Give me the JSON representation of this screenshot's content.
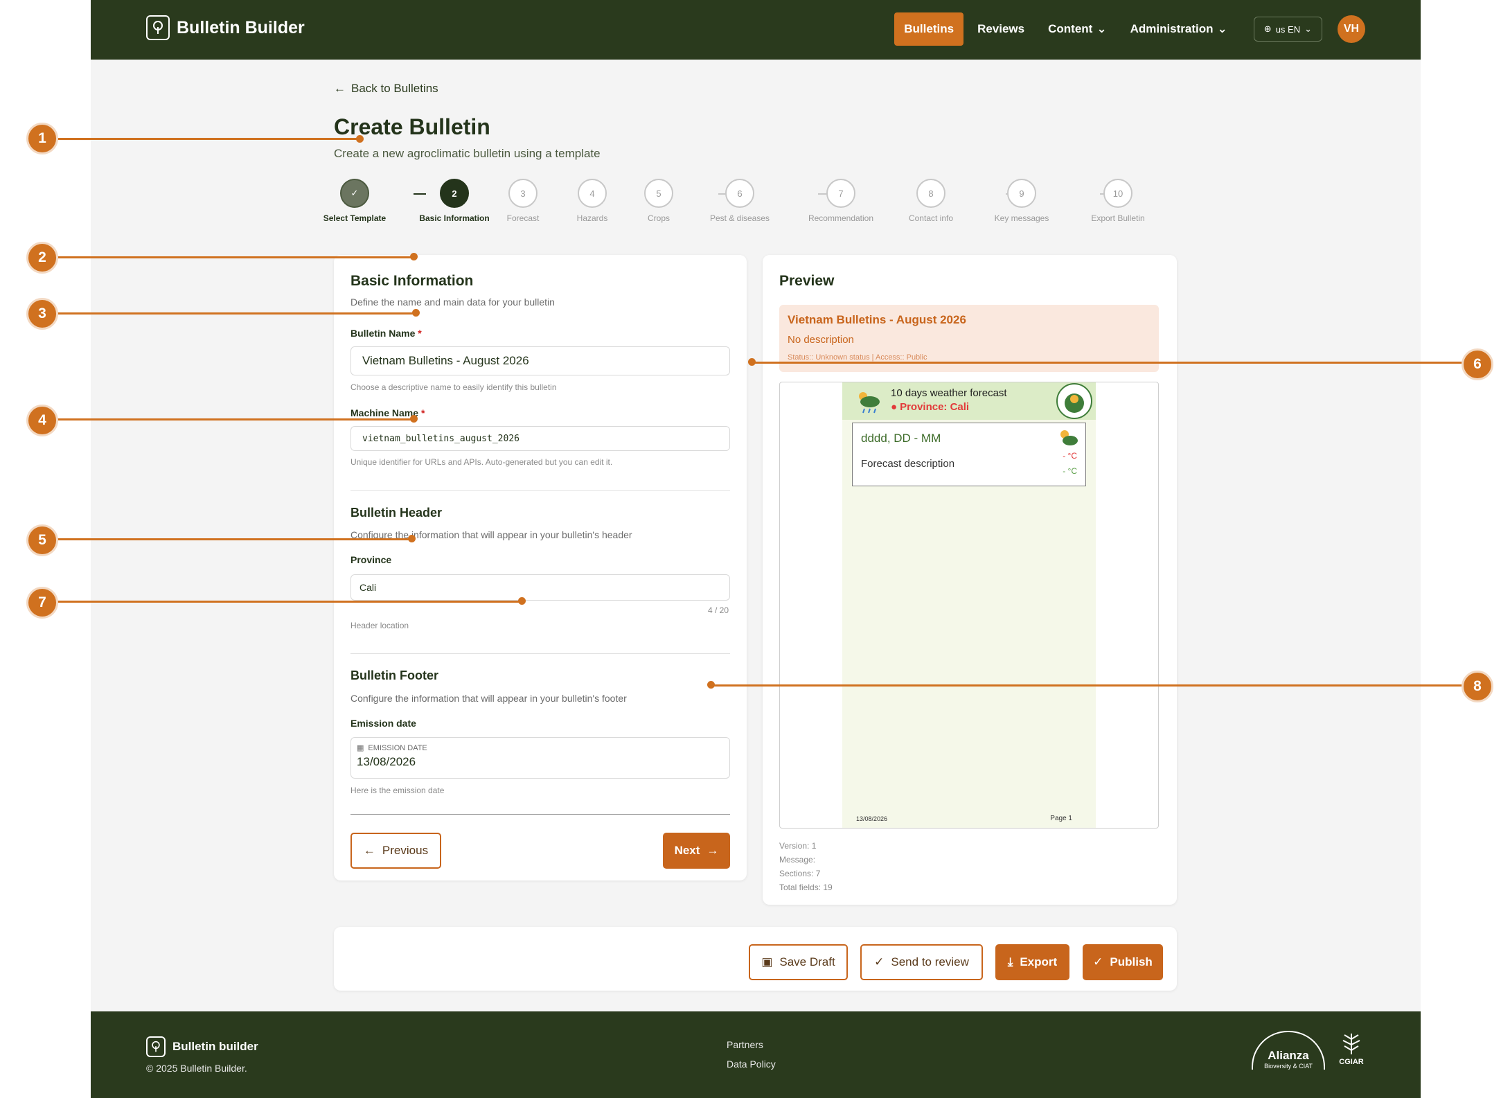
{
  "header": {
    "brand": "Bulletin Builder",
    "nav": [
      {
        "label": "Bulletins"
      },
      {
        "label": "Reviews"
      },
      {
        "label": "Content"
      },
      {
        "label": "Administration"
      }
    ],
    "lang": "us EN",
    "avatar": "VH"
  },
  "page": {
    "back": "Back to Bulletins",
    "title": "Create Bulletin",
    "subtitle": "Create a new agroclimatic bulletin using a template"
  },
  "steps": [
    {
      "num": "",
      "label": "Select Template"
    },
    {
      "num": "2",
      "label": "Basic Information"
    },
    {
      "num": "3",
      "label": "Forecast"
    },
    {
      "num": "4",
      "label": "Hazards"
    },
    {
      "num": "5",
      "label": "Crops"
    },
    {
      "num": "6",
      "label": "Pest & diseases"
    },
    {
      "num": "7",
      "label": "Recommendation"
    },
    {
      "num": "8",
      "label": "Contact info"
    },
    {
      "num": "9",
      "label": "Key messages"
    },
    {
      "num": "10",
      "label": "Export Bulletin"
    }
  ],
  "form": {
    "basic_title": "Basic Information",
    "basic_sub": "Define the name and main data for your bulletin",
    "name_label": "Bulletin Name",
    "name_value": "Vietnam Bulletins - August 2026",
    "name_hint": "Choose a descriptive name to easily identify this bulletin",
    "machine_label": "Machine Name",
    "machine_value": "vietnam_bulletins_august_2026",
    "machine_hint": "Unique identifier for URLs and APIs. Auto-generated but you can edit it.",
    "header_title": "Bulletin Header",
    "header_sub": "Configure the information that will appear in your bulletin's header",
    "province_label": "Province",
    "province_value": "Cali",
    "province_count": "4 / 20",
    "province_hint": "Header location",
    "footer_title": "Bulletin Footer",
    "footer_sub": "Configure the information that will appear in your bulletin's footer",
    "emission_label": "Emission date",
    "emission_mini": "EMISSION DATE",
    "emission_value": "13/08/2026",
    "emission_hint": "Here is the emission date",
    "prev_btn": "Previous",
    "next_btn": "Next"
  },
  "preview": {
    "title": "Preview",
    "bulletin_name": "Vietnam Bulletins - August 2026",
    "description": "No description",
    "status": "Status:: Unknown status | Access:: Public",
    "sheet_title": "10 days weather forecast",
    "sheet_province": "Province: Cali",
    "day_date": "dddd, DD - MM",
    "day_desc": "Forecast description",
    "temp_max": "- °C",
    "temp_min": "- °C",
    "footer_date": "13/08/2026",
    "footer_page": "Page 1",
    "meta": [
      "Version: 1",
      "Message:",
      "Sections: 7",
      "Total fields: 19"
    ]
  },
  "actions": {
    "save": "Save Draft",
    "review": "Send to review",
    "export": "Export",
    "publish": "Publish"
  },
  "footer": {
    "brand": "Bulletin builder",
    "copy": "© 2025 Bulletin Builder.",
    "links": [
      "Partners",
      "Data Policy"
    ],
    "logo1": "Alianza",
    "logo1_sub": "Bioversity & CIAT",
    "logo2": "CGIAR"
  },
  "callouts": [
    "1",
    "2",
    "3",
    "4",
    "5",
    "6",
    "7",
    "8"
  ],
  "colors": {
    "brand_dark": "#2a3a1d",
    "accent": "#d0711f"
  }
}
